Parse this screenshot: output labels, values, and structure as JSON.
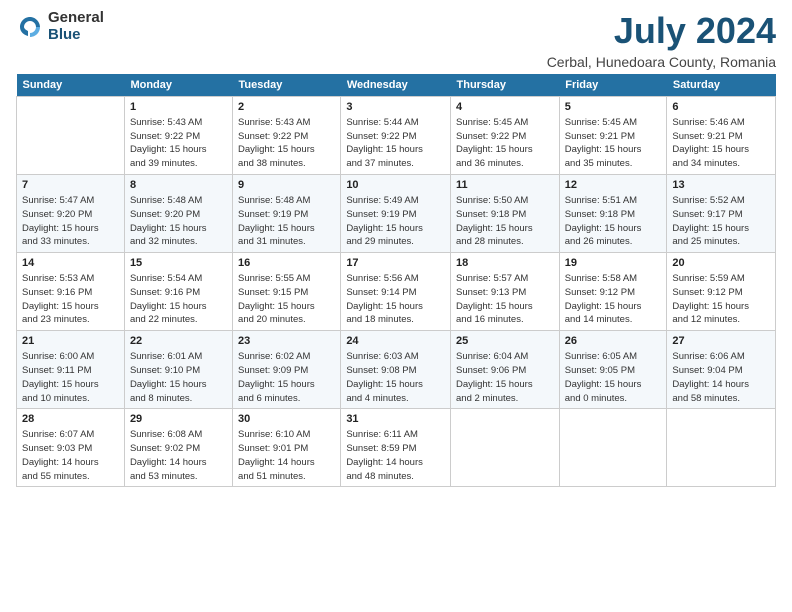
{
  "header": {
    "logo_general": "General",
    "logo_blue": "Blue",
    "month": "July 2024",
    "location": "Cerbal, Hunedoara County, Romania"
  },
  "columns": [
    "Sunday",
    "Monday",
    "Tuesday",
    "Wednesday",
    "Thursday",
    "Friday",
    "Saturday"
  ],
  "weeks": [
    [
      {
        "day": "",
        "info": ""
      },
      {
        "day": "1",
        "info": "Sunrise: 5:43 AM\nSunset: 9:22 PM\nDaylight: 15 hours\nand 39 minutes."
      },
      {
        "day": "2",
        "info": "Sunrise: 5:43 AM\nSunset: 9:22 PM\nDaylight: 15 hours\nand 38 minutes."
      },
      {
        "day": "3",
        "info": "Sunrise: 5:44 AM\nSunset: 9:22 PM\nDaylight: 15 hours\nand 37 minutes."
      },
      {
        "day": "4",
        "info": "Sunrise: 5:45 AM\nSunset: 9:22 PM\nDaylight: 15 hours\nand 36 minutes."
      },
      {
        "day": "5",
        "info": "Sunrise: 5:45 AM\nSunset: 9:21 PM\nDaylight: 15 hours\nand 35 minutes."
      },
      {
        "day": "6",
        "info": "Sunrise: 5:46 AM\nSunset: 9:21 PM\nDaylight: 15 hours\nand 34 minutes."
      }
    ],
    [
      {
        "day": "7",
        "info": "Sunrise: 5:47 AM\nSunset: 9:20 PM\nDaylight: 15 hours\nand 33 minutes."
      },
      {
        "day": "8",
        "info": "Sunrise: 5:48 AM\nSunset: 9:20 PM\nDaylight: 15 hours\nand 32 minutes."
      },
      {
        "day": "9",
        "info": "Sunrise: 5:48 AM\nSunset: 9:19 PM\nDaylight: 15 hours\nand 31 minutes."
      },
      {
        "day": "10",
        "info": "Sunrise: 5:49 AM\nSunset: 9:19 PM\nDaylight: 15 hours\nand 29 minutes."
      },
      {
        "day": "11",
        "info": "Sunrise: 5:50 AM\nSunset: 9:18 PM\nDaylight: 15 hours\nand 28 minutes."
      },
      {
        "day": "12",
        "info": "Sunrise: 5:51 AM\nSunset: 9:18 PM\nDaylight: 15 hours\nand 26 minutes."
      },
      {
        "day": "13",
        "info": "Sunrise: 5:52 AM\nSunset: 9:17 PM\nDaylight: 15 hours\nand 25 minutes."
      }
    ],
    [
      {
        "day": "14",
        "info": "Sunrise: 5:53 AM\nSunset: 9:16 PM\nDaylight: 15 hours\nand 23 minutes."
      },
      {
        "day": "15",
        "info": "Sunrise: 5:54 AM\nSunset: 9:16 PM\nDaylight: 15 hours\nand 22 minutes."
      },
      {
        "day": "16",
        "info": "Sunrise: 5:55 AM\nSunset: 9:15 PM\nDaylight: 15 hours\nand 20 minutes."
      },
      {
        "day": "17",
        "info": "Sunrise: 5:56 AM\nSunset: 9:14 PM\nDaylight: 15 hours\nand 18 minutes."
      },
      {
        "day": "18",
        "info": "Sunrise: 5:57 AM\nSunset: 9:13 PM\nDaylight: 15 hours\nand 16 minutes."
      },
      {
        "day": "19",
        "info": "Sunrise: 5:58 AM\nSunset: 9:12 PM\nDaylight: 15 hours\nand 14 minutes."
      },
      {
        "day": "20",
        "info": "Sunrise: 5:59 AM\nSunset: 9:12 PM\nDaylight: 15 hours\nand 12 minutes."
      }
    ],
    [
      {
        "day": "21",
        "info": "Sunrise: 6:00 AM\nSunset: 9:11 PM\nDaylight: 15 hours\nand 10 minutes."
      },
      {
        "day": "22",
        "info": "Sunrise: 6:01 AM\nSunset: 9:10 PM\nDaylight: 15 hours\nand 8 minutes."
      },
      {
        "day": "23",
        "info": "Sunrise: 6:02 AM\nSunset: 9:09 PM\nDaylight: 15 hours\nand 6 minutes."
      },
      {
        "day": "24",
        "info": "Sunrise: 6:03 AM\nSunset: 9:08 PM\nDaylight: 15 hours\nand 4 minutes."
      },
      {
        "day": "25",
        "info": "Sunrise: 6:04 AM\nSunset: 9:06 PM\nDaylight: 15 hours\nand 2 minutes."
      },
      {
        "day": "26",
        "info": "Sunrise: 6:05 AM\nSunset: 9:05 PM\nDaylight: 15 hours\nand 0 minutes."
      },
      {
        "day": "27",
        "info": "Sunrise: 6:06 AM\nSunset: 9:04 PM\nDaylight: 14 hours\nand 58 minutes."
      }
    ],
    [
      {
        "day": "28",
        "info": "Sunrise: 6:07 AM\nSunset: 9:03 PM\nDaylight: 14 hours\nand 55 minutes."
      },
      {
        "day": "29",
        "info": "Sunrise: 6:08 AM\nSunset: 9:02 PM\nDaylight: 14 hours\nand 53 minutes."
      },
      {
        "day": "30",
        "info": "Sunrise: 6:10 AM\nSunset: 9:01 PM\nDaylight: 14 hours\nand 51 minutes."
      },
      {
        "day": "31",
        "info": "Sunrise: 6:11 AM\nSunset: 8:59 PM\nDaylight: 14 hours\nand 48 minutes."
      },
      {
        "day": "",
        "info": ""
      },
      {
        "day": "",
        "info": ""
      },
      {
        "day": "",
        "info": ""
      }
    ]
  ]
}
